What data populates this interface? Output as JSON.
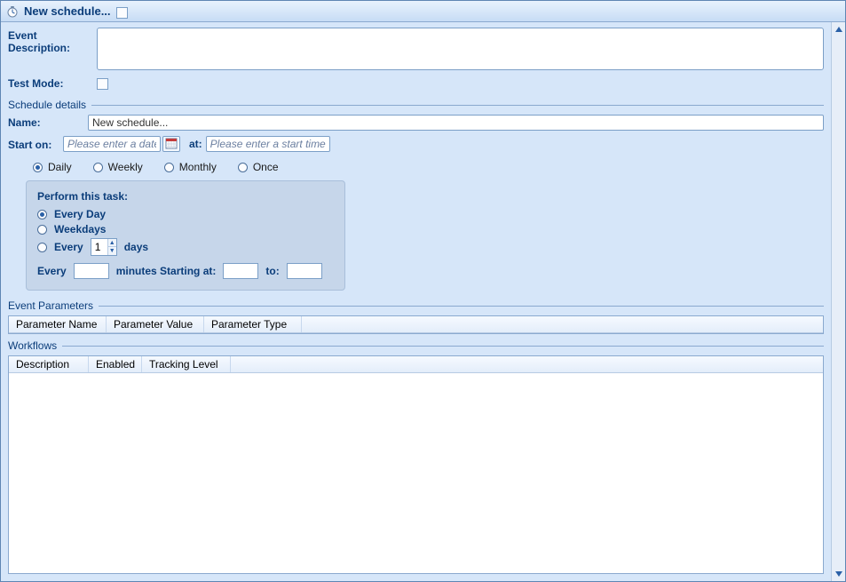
{
  "window": {
    "title": "New schedule...",
    "title_checkbox_checked": false
  },
  "fields": {
    "event_description_label": "Event Description:",
    "event_description_value": "",
    "test_mode_label": "Test Mode:",
    "test_mode_checked": false
  },
  "schedule_details": {
    "header": "Schedule details",
    "name_label": "Name:",
    "name_value": "New schedule...",
    "start_on_label": "Start on:",
    "date_placeholder": "Please enter a date",
    "date_value": "",
    "at_label": "at:",
    "time_placeholder": "Please enter a start time",
    "time_value": "",
    "frequency": {
      "options": [
        "Daily",
        "Weekly",
        "Monthly",
        "Once"
      ],
      "selected": "Daily"
    },
    "task_panel": {
      "header": "Perform this task:",
      "options": {
        "every_day": "Every Day",
        "weekdays": "Weekdays",
        "every_prefix": "Every",
        "every_value": "1",
        "every_suffix": "days"
      },
      "selected": "every_day",
      "minutes_row": {
        "every_label": "Every",
        "minutes_value": "",
        "minutes_label": "minutes Starting at:",
        "start_value": "",
        "to_label": "to:",
        "to_value": ""
      }
    }
  },
  "event_parameters": {
    "header": "Event Parameters",
    "columns": [
      "Parameter Name",
      "Parameter Value",
      "Parameter Type"
    ],
    "rows": []
  },
  "workflows": {
    "header": "Workflows",
    "columns": [
      "Description",
      "Enabled",
      "Tracking Level"
    ],
    "rows": []
  }
}
